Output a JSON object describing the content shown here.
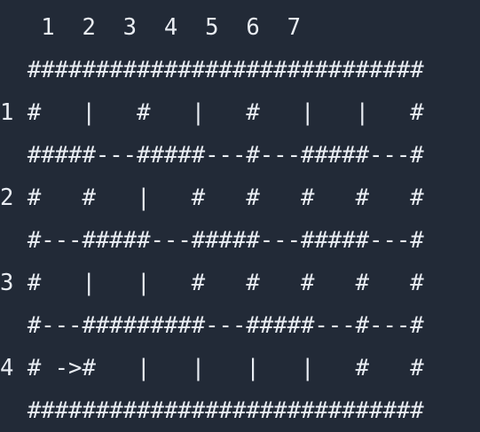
{
  "maze": {
    "column_header": "   1  2  3  4  5  6  7",
    "lines": [
      "  #############################",
      "1 #   |   #   |   #   |   |   #",
      "  #####---#####---#---#####---#",
      "2 #   #   |   #   #   #   #   #",
      "  #---#####---#####---#####---#",
      "3 #   |   |   #   #   #   #   #",
      "  #---#########---#####---#---#",
      "4 # ->#   |   |   |   |   #   #",
      "  #############################"
    ]
  },
  "colors": {
    "background": "#222a37",
    "text": "#e9edf3"
  }
}
